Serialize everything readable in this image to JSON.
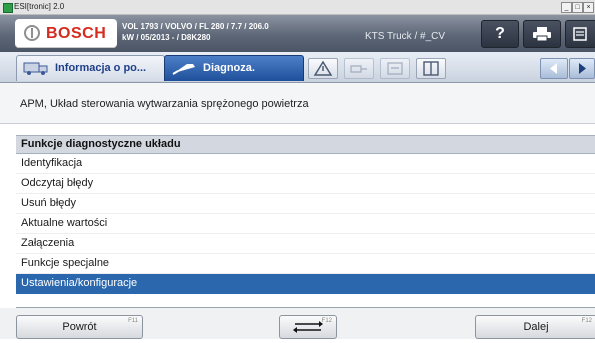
{
  "window": {
    "title": "ESI[tronic] 2.0",
    "controls": {
      "minimize": "_",
      "maximize": "□",
      "close": "×"
    }
  },
  "header": {
    "brand": "BOSCH",
    "vehicle_line1": "VOL 1793 / VOLVO / FL 280 / 7.7 / 206.0",
    "vehicle_line2": "kW / 05/2013 - / D8K280",
    "device": "KTS Truck / #_CV",
    "help_label": "?"
  },
  "tabs": [
    {
      "label": "Informacja o po...",
      "icon": "truck-info-icon",
      "active": false
    },
    {
      "label": "Diagnoza.",
      "icon": "diagnosis-probe-icon",
      "active": true
    }
  ],
  "toolbar": {
    "icons": [
      "warning-triangle-icon",
      "connector-icon",
      "component-icon",
      "book-icon"
    ]
  },
  "context": {
    "text": "APM, Układ sterowania wytwarzania sprężonego powietrza"
  },
  "list": {
    "header": "Funkcje diagnostyczne układu",
    "items": [
      {
        "label": "Identyfikacja",
        "selected": false
      },
      {
        "label": "Odczytaj błędy",
        "selected": false
      },
      {
        "label": "Usuń błędy",
        "selected": false
      },
      {
        "label": "Aktualne wartości",
        "selected": false
      },
      {
        "label": "Załączenia",
        "selected": false
      },
      {
        "label": "Funkcje specjalne",
        "selected": false
      },
      {
        "label": "Ustawienia/konfiguracje",
        "selected": true
      }
    ]
  },
  "footer": {
    "back_label": "Powrót",
    "back_key": "F11",
    "switch_key": "F12",
    "next_label": "Dalej",
    "next_key": "F12"
  },
  "colors": {
    "selection": "#2a67ad",
    "brand_red": "#d52b1e",
    "active_tab": "#1f4f9a"
  }
}
